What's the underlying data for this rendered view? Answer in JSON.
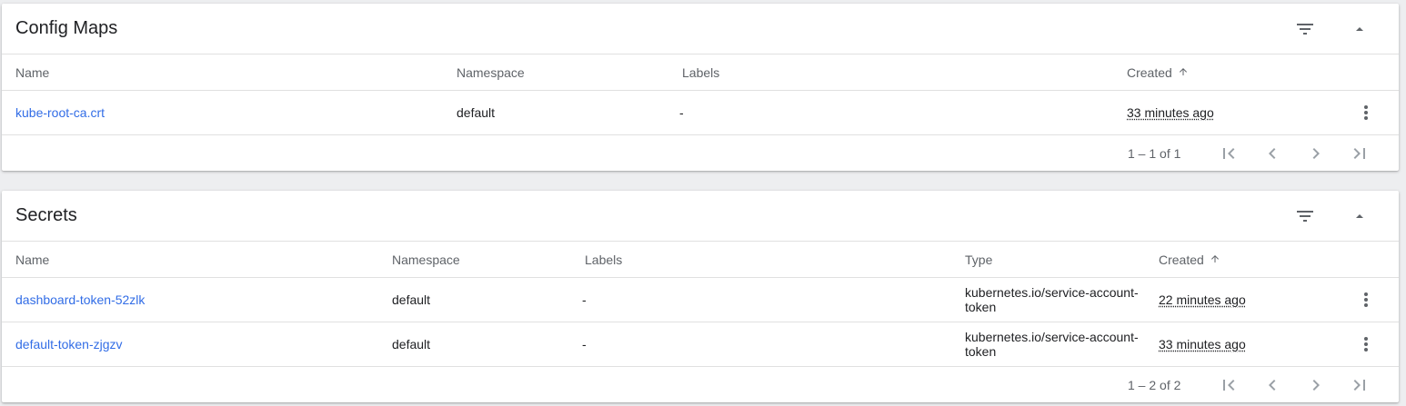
{
  "colors": {
    "link": "#326de6",
    "header_text": "#5f6368",
    "background": "#edeef0"
  },
  "config_maps": {
    "title": "Config Maps",
    "columns": {
      "name": "Name",
      "namespace": "Namespace",
      "labels": "Labels",
      "created": "Created"
    },
    "rows": [
      {
        "name": "kube-root-ca.crt",
        "namespace": "default",
        "labels": "-",
        "created": "33 minutes ago"
      }
    ],
    "pagination": "1 – 1 of 1"
  },
  "secrets": {
    "title": "Secrets",
    "columns": {
      "name": "Name",
      "namespace": "Namespace",
      "labels": "Labels",
      "type": "Type",
      "created": "Created"
    },
    "rows": [
      {
        "name": "dashboard-token-52zlk",
        "namespace": "default",
        "labels": "-",
        "type": "kubernetes.io/service-account-token",
        "created": "22 minutes ago"
      },
      {
        "name": "default-token-zjgzv",
        "namespace": "default",
        "labels": "-",
        "type": "kubernetes.io/service-account-token",
        "created": "33 minutes ago"
      }
    ],
    "pagination": "1 – 2 of 2"
  },
  "icons": {
    "filter": "filter-list-icon",
    "collapse": "expand-less-icon",
    "sort": "arrow-upward-icon",
    "row_menu": "more-vert-icon",
    "first_page": "first-page-icon",
    "prev_page": "chevron-left-icon",
    "next_page": "chevron-right-icon",
    "last_page": "last-page-icon"
  }
}
